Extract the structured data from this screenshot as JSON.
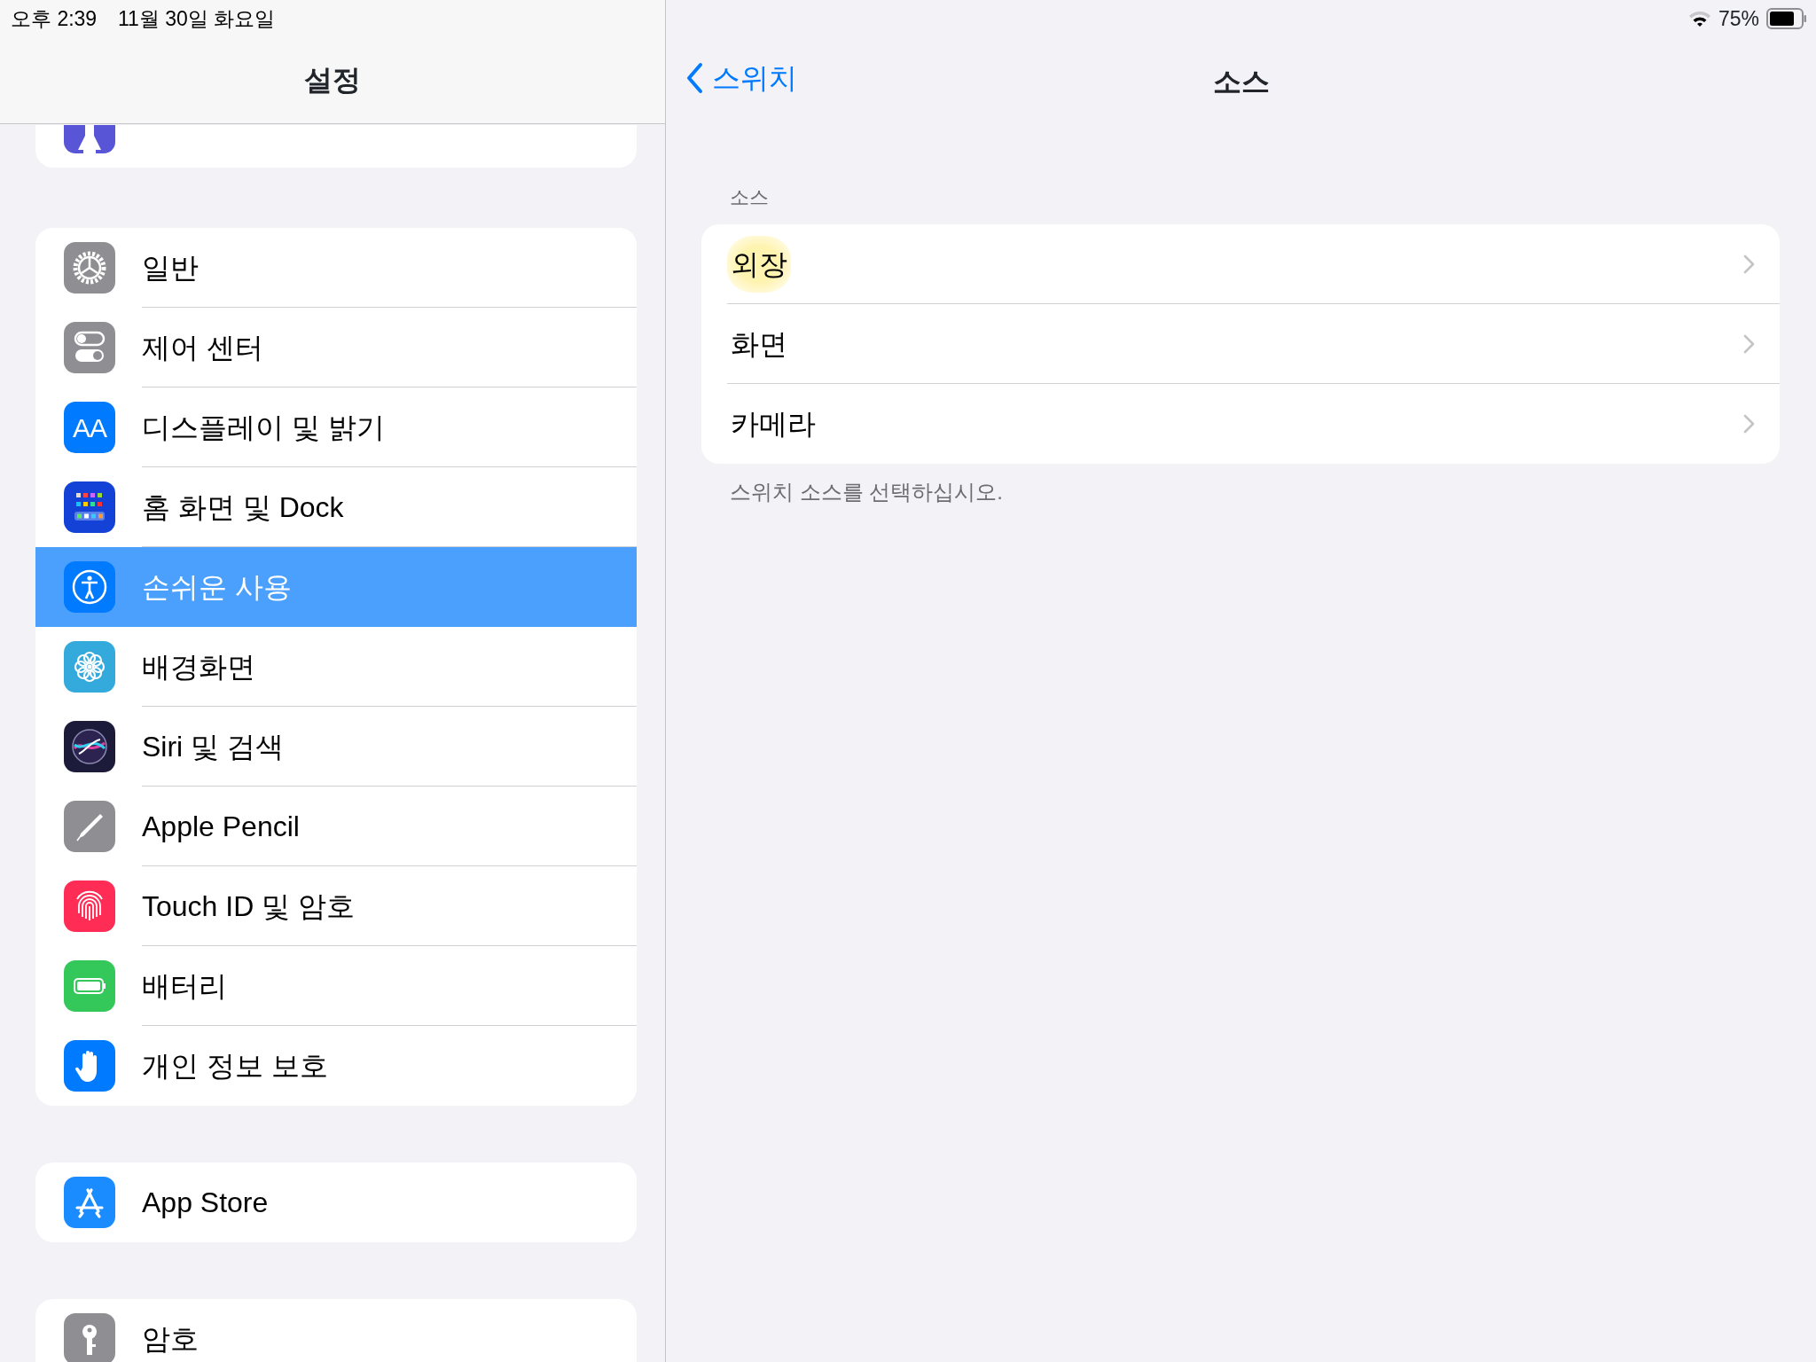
{
  "sidebar": {
    "status": {
      "time": "오후 2:39",
      "date": "11월 30일 화요일"
    },
    "title": "설정",
    "groups": [
      {
        "items": [
          {
            "kind": "hourglass"
          }
        ]
      },
      {
        "items": [
          {
            "label": "일반",
            "kind": "gear",
            "selected": false
          },
          {
            "label": "제어 센터",
            "kind": "toggles",
            "selected": false
          },
          {
            "label": "디스플레이 및 밝기",
            "kind": "text",
            "icon_label": "AA",
            "selected": false
          },
          {
            "label": "홈 화면 및 Dock",
            "kind": "grid",
            "selected": false
          },
          {
            "label": "손쉬운 사용",
            "kind": "accessibility",
            "selected": true
          },
          {
            "label": "배경화면",
            "kind": "flower",
            "selected": false
          },
          {
            "label": "Siri 및 검색",
            "kind": "siri",
            "selected": false
          },
          {
            "label": "Apple Pencil",
            "kind": "pencil",
            "selected": false
          },
          {
            "label": "Touch ID 및 암호",
            "kind": "fingerprint",
            "selected": false
          },
          {
            "label": "배터리",
            "kind": "battery",
            "selected": false
          },
          {
            "label": "개인 정보 보호",
            "kind": "hand",
            "selected": false
          }
        ]
      },
      {
        "items": [
          {
            "label": "App Store",
            "kind": "appstore",
            "selected": false
          }
        ]
      },
      {
        "items": [
          {
            "label": "암호",
            "kind": "key",
            "selected": false
          }
        ]
      }
    ]
  },
  "detail": {
    "battery_text": "75%",
    "back": "스위치",
    "title": "소스",
    "section_header": "소스",
    "rows": [
      {
        "label": "외장",
        "highlighted": true
      },
      {
        "label": "화면",
        "highlighted": false
      },
      {
        "label": "카메라",
        "highlighted": false
      }
    ],
    "footer": "스위치 소스를 선택하십시오."
  }
}
